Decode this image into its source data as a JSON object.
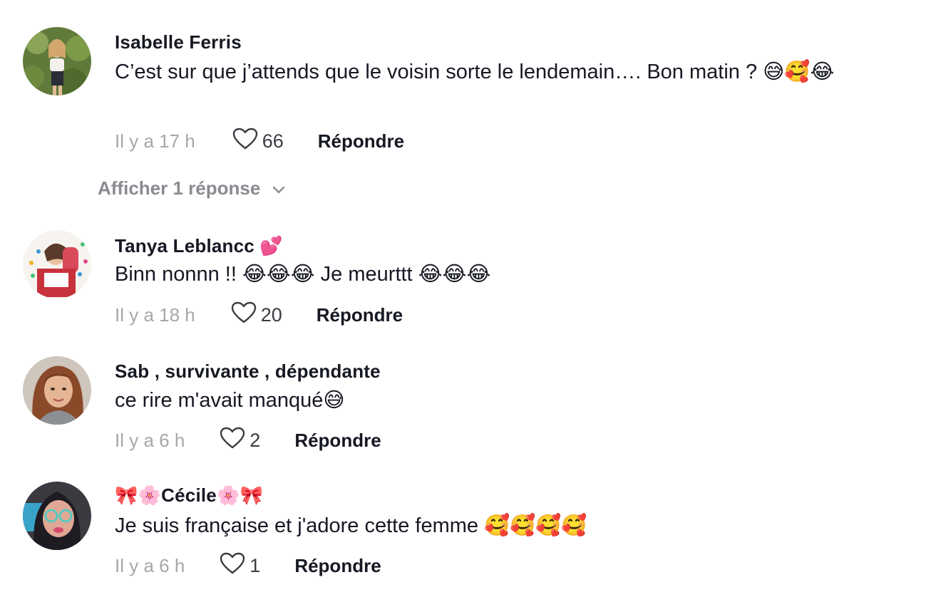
{
  "comments": [
    {
      "username": "Isabelle Ferris",
      "text": "C’est sur que j’attends que le voisin sorte le lendemain…. Bon matin ? 😅🥰😂",
      "time": "Il y a 17 h",
      "likes": "66",
      "reply_label": "Répondre",
      "replies_toggle": "Afficher 1 réponse"
    },
    {
      "username": "Tanya Leblancc 💕",
      "text": "Binn nonnn !! 😂😂😂 Je meurttt 😂😂😂",
      "time": "Il y a 18 h",
      "likes": "20",
      "reply_label": "Répondre"
    },
    {
      "username": "Sab , survivante , dépendante",
      "text": "ce rire m'avait manqué😅",
      "time": "Il y a 6 h",
      "likes": "2",
      "reply_label": "Répondre"
    },
    {
      "username": "🎀🌸Cécile🌸🎀",
      "text": "Je suis française et j'adore cette femme 🥰🥰🥰🥰",
      "time": "Il y a 6 h",
      "likes": "1",
      "reply_label": "Répondre"
    }
  ],
  "icons": {
    "like": "heart-outline-icon",
    "expand": "chevron-down-icon"
  },
  "colors": {
    "text_primary": "#161823",
    "text_secondary": "#a6a7ab",
    "toggle_text": "#8a8b91"
  }
}
